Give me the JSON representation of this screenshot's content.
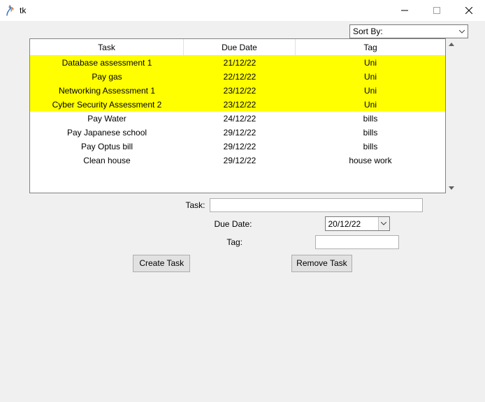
{
  "window": {
    "title": "tk"
  },
  "sort": {
    "label": "Sort By:"
  },
  "columns": {
    "task": "Task",
    "date": "Due Date",
    "tag": "Tag"
  },
  "rows": [
    {
      "task": "Database assessment 1",
      "date": "21/12/22",
      "tag": "Uni",
      "highlight": true
    },
    {
      "task": "Pay gas",
      "date": "22/12/22",
      "tag": "Uni",
      "highlight": true
    },
    {
      "task": "Networking Assessment 1",
      "date": "23/12/22",
      "tag": "Uni",
      "highlight": true
    },
    {
      "task": "Cyber Security Assessment 2",
      "date": "23/12/22",
      "tag": "Uni",
      "highlight": true
    },
    {
      "task": "Pay Water",
      "date": "24/12/22",
      "tag": "bills",
      "highlight": false
    },
    {
      "task": "Pay Japanese school",
      "date": "29/12/22",
      "tag": "bills",
      "highlight": false
    },
    {
      "task": "Pay Optus bill",
      "date": "29/12/22",
      "tag": "bills",
      "highlight": false
    },
    {
      "task": "Clean house",
      "date": "29/12/22",
      "tag": "house work",
      "highlight": false
    }
  ],
  "form": {
    "task_label": "Task:",
    "task_value": "",
    "date_label": "Due Date:",
    "date_value": "20/12/22",
    "tag_label": "Tag:",
    "tag_value": ""
  },
  "buttons": {
    "create": "Create Task",
    "remove": "Remove Task"
  }
}
